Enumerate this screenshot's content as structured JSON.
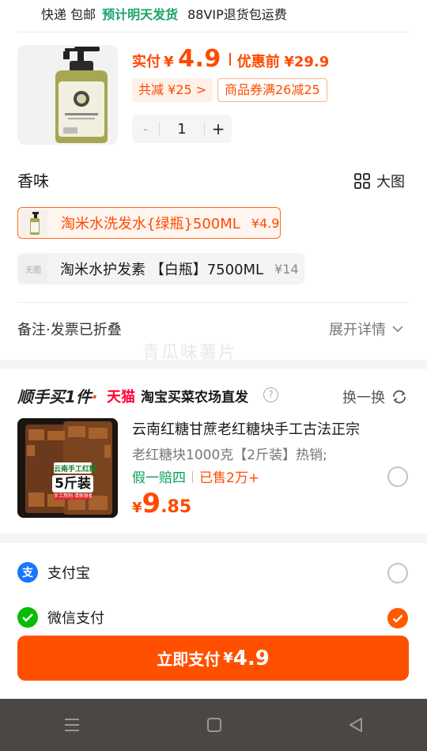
{
  "shipping": {
    "delivery": "快递 包邮",
    "eta": "预计明天发货",
    "vip": "88VIP退货包运费"
  },
  "product": {
    "image_icon": "shampoo-bottle",
    "paid_label": "实付",
    "currency": "¥",
    "paid_price": "4.9",
    "before_label": "优惠前",
    "before_price": "¥29.9",
    "discount_tag": "共减 ¥25 >",
    "coupon_tag": "商品券满26减25",
    "qty_minus": "-",
    "quantity": "1",
    "qty_plus": "+"
  },
  "scent": {
    "title": "香味",
    "bigview_label": "大图",
    "options": [
      {
        "name": "淘米水洗发水{绿瓶}500ML",
        "price": "¥4.9",
        "thumb": "",
        "selected": true
      },
      {
        "name": "淘米水护发素 【白瓶】7500ML",
        "price": "¥14",
        "thumb": "无图",
        "selected": false
      }
    ]
  },
  "remark": {
    "label": "备注·发票已折叠",
    "expand": "展开详情"
  },
  "watermark": "青瓜味薯片",
  "recommend": {
    "logo": "顺手买1件",
    "logo_dot": "·",
    "platform": "天猫",
    "shop": "淘宝买菜农场直发",
    "help": "?",
    "swap": "换一换",
    "image_text_1": "云南手工红糖",
    "image_text_2": "5斤装",
    "image_text_3": "手工熬制 清新原香",
    "title": "云南红糖甘蔗老红糖块手工古法正宗",
    "subtitle": "老红糖块1000克【2斤装】热销;",
    "badge_guarantee": "假一赔四",
    "badge_sold": "已售2万+",
    "price_currency": "¥",
    "price_int": "9",
    "price_dec": ".85"
  },
  "payment": {
    "alipay": {
      "label": "支付宝",
      "icon": "alipay-icon",
      "icon_glyph": "支",
      "color": "#1677ff",
      "selected": false
    },
    "wechat": {
      "label": "微信支付",
      "icon": "wechat-pay-icon",
      "color": "#09bb07",
      "selected": true
    }
  },
  "pay_button": {
    "label": "立即支付",
    "currency": "¥",
    "amount": "4.9"
  },
  "colors": {
    "accent": "#ff5000",
    "price": "#ff4a00",
    "green": "#1aa36a"
  }
}
